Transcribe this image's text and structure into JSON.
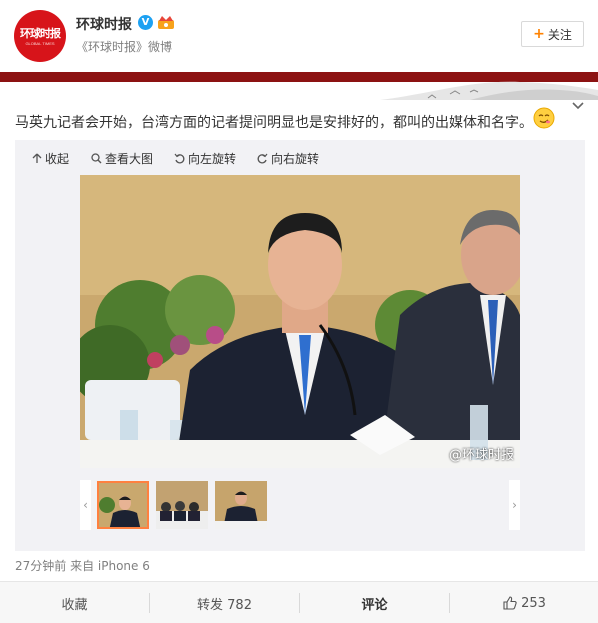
{
  "header": {
    "avatar_logo_text": "环球时报",
    "avatar_logo_sub": "GLOBAL TIMES",
    "user_name": "环球时报",
    "source": "《环球时报》微博",
    "follow_label": "关注"
  },
  "post": {
    "text": "马英九记者会开始，台湾方面的记者提问明显也是安排好的，都叫的出媒体和名字。"
  },
  "media": {
    "toolbar": {
      "collapse_label": "收起",
      "view_large_label": "查看大图",
      "rotate_left_label": "向左旋转",
      "rotate_right_label": "向右旋转"
    },
    "watermark": "@环球时报",
    "thumbnail_count": 3,
    "active_thumbnail": 1
  },
  "meta": {
    "timestamp": "27分钟前 来自 iPhone 6"
  },
  "actions": {
    "favorite_label": "收藏",
    "repost_label": "转发 782",
    "comment_label": "评论",
    "like_count": "253"
  },
  "colors": {
    "brand_red": "#d7141a",
    "banner_red": "#8c1212",
    "verified_blue": "#1da1f2",
    "accent_orange": "#ff8200",
    "thumb_active": "#ff8140"
  }
}
